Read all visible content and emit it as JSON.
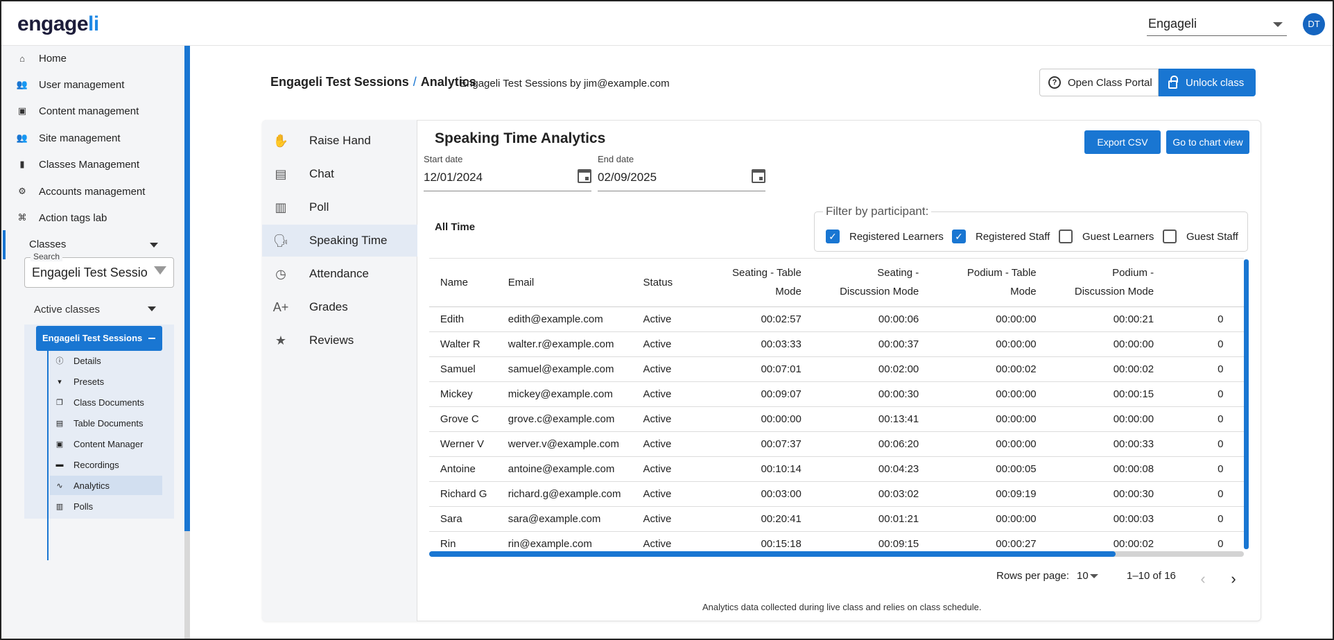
{
  "logo": {
    "prefix": "e",
    "mid": "ngage",
    "suffix": "li"
  },
  "org_select": {
    "value": "Engageli"
  },
  "avatar": {
    "initials": "DT"
  },
  "sidebar": {
    "nav": [
      {
        "label": "Home",
        "icon": "home-icon"
      },
      {
        "label": "User management",
        "icon": "users-icon"
      },
      {
        "label": "Content management",
        "icon": "photos-icon"
      },
      {
        "label": "Site management",
        "icon": "users-icon"
      },
      {
        "label": "Classes Management",
        "icon": "book-icon"
      },
      {
        "label": "Accounts management",
        "icon": "account-settings-icon"
      },
      {
        "label": "Action tags lab",
        "icon": "tags-icon"
      }
    ],
    "classes_label": "Classes",
    "search": {
      "label": "Search",
      "value": "Engageli Test Sessio"
    },
    "active_classes_label": "Active classes",
    "class_chip": "Engageli Test Sessions",
    "sub_items": [
      {
        "label": "Details",
        "icon": "info-icon"
      },
      {
        "label": "Presets",
        "icon": "presets-icon"
      },
      {
        "label": "Class Documents",
        "icon": "documents-icon"
      },
      {
        "label": "Table Documents",
        "icon": "document-icon"
      },
      {
        "label": "Content Manager",
        "icon": "photos-icon"
      },
      {
        "label": "Recordings",
        "icon": "recordings-icon"
      },
      {
        "label": "Analytics",
        "icon": "analytics-icon"
      },
      {
        "label": "Polls",
        "icon": "poll-icon"
      }
    ]
  },
  "header": {
    "breadcrumb_root": "Engageli Test Sessions",
    "breadcrumb_sep": "/",
    "breadcrumb_current": "Analytics",
    "subtitle": "Engageli Test Sessions by jim@example.com",
    "open_portal": "Open Class Portal",
    "unlock": "Unlock class"
  },
  "menu": [
    {
      "label": "Raise Hand",
      "icon": "hand-icon"
    },
    {
      "label": "Chat",
      "icon": "chat-icon"
    },
    {
      "label": "Poll",
      "icon": "poll-icon"
    },
    {
      "label": "Speaking Time",
      "icon": "speaking-icon"
    },
    {
      "label": "Attendance",
      "icon": "clock-icon"
    },
    {
      "label": "Grades",
      "icon": "grades-icon"
    },
    {
      "label": "Reviews",
      "icon": "star-icon"
    }
  ],
  "panel": {
    "title": "Speaking Time Analytics",
    "export_csv": "Export CSV",
    "chart_view": "Go to chart view",
    "start_label": "Start date",
    "start_value": "12/01/2024",
    "end_label": "End date",
    "end_value": "02/09/2025",
    "all_time": "All Time",
    "filter_label": "Filter by participant:",
    "filters": [
      {
        "label": "Registered Learners",
        "checked": true
      },
      {
        "label": "Registered Staff",
        "checked": true
      },
      {
        "label": "Guest Learners",
        "checked": false
      },
      {
        "label": "Guest Staff",
        "checked": false
      }
    ]
  },
  "table": {
    "headers": {
      "name": "Name",
      "email": "Email",
      "status": "Status",
      "seating_table_1": "Seating - Table",
      "seating_table_2": "Mode",
      "seating_disc_1": "Seating -",
      "seating_disc_2": "Discussion Mode",
      "podium_table_1": "Podium - Table",
      "podium_table_2": "Mode",
      "podium_disc_1": "Podium -",
      "podium_disc_2": "Discussion Mode"
    },
    "rows": [
      {
        "name": "Edith",
        "email": "edith@example.com",
        "status": "Active",
        "st": "00:02:57",
        "sd": "00:00:06",
        "pt": "00:00:00",
        "pd": "00:00:21"
      },
      {
        "name": "Walter R",
        "email": "walter.r@example.com",
        "status": "Active",
        "st": "00:03:33",
        "sd": "00:00:37",
        "pt": "00:00:00",
        "pd": "00:00:00"
      },
      {
        "name": "Samuel",
        "email": "samuel@example.com",
        "status": "Active",
        "st": "00:07:01",
        "sd": "00:02:00",
        "pt": "00:00:02",
        "pd": "00:00:02"
      },
      {
        "name": "Mickey",
        "email": "mickey@example.com",
        "status": "Active",
        "st": "00:09:07",
        "sd": "00:00:30",
        "pt": "00:00:00",
        "pd": "00:00:15"
      },
      {
        "name": "Grove C",
        "email": "grove.c@example.com",
        "status": "Active",
        "st": "00:00:00",
        "sd": "00:13:41",
        "pt": "00:00:00",
        "pd": "00:00:00"
      },
      {
        "name": "Werner V",
        "email": "werver.v@example.com",
        "status": "Active",
        "st": "00:07:37",
        "sd": "00:06:20",
        "pt": "00:00:00",
        "pd": "00:00:33"
      },
      {
        "name": "Antoine",
        "email": "antoine@example.com",
        "status": "Active",
        "st": "00:10:14",
        "sd": "00:04:23",
        "pt": "00:00:05",
        "pd": "00:00:08"
      },
      {
        "name": "Richard G",
        "email": "richard.g@example.com",
        "status": "Active",
        "st": "00:03:00",
        "sd": "00:03:02",
        "pt": "00:09:19",
        "pd": "00:00:30"
      },
      {
        "name": "Sara",
        "email": "sara@example.com",
        "status": "Active",
        "st": "00:20:41",
        "sd": "00:01:21",
        "pt": "00:00:00",
        "pd": "00:00:03"
      },
      {
        "name": "Rin",
        "email": "rin@example.com",
        "status": "Active",
        "st": "00:15:18",
        "sd": "00:09:15",
        "pt": "00:00:27",
        "pd": "00:00:02"
      }
    ],
    "cut_off_glyph": "0"
  },
  "pagination": {
    "rows_per_page_label": "Rows per page:",
    "rows_per_page": "10",
    "range": "1–10 of 16"
  },
  "footnote": "Analytics data collected during live class and relies on class schedule.",
  "colors": {
    "accent": "#1976d2",
    "selected_bg": "#e3eaf4"
  }
}
